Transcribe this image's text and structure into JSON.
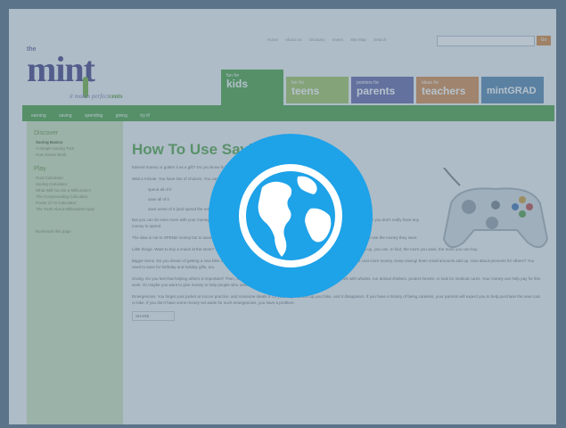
{
  "topbar": {
    "links": [
      "Home",
      "About Us",
      "Glossary",
      "Invest",
      "Site Map",
      "Search"
    ],
    "search_button": "Go"
  },
  "logo": {
    "the": "the",
    "mint": "mint",
    "tagline": "it makes perfect",
    "tagline_emphasis": "cents"
  },
  "tabs": [
    {
      "small": "fun for",
      "big": "kids"
    },
    {
      "small": "fun for",
      "big": "teens"
    },
    {
      "small": "pointers for",
      "big": "parents"
    },
    {
      "small": "ideas for",
      "big": "teachers"
    },
    {
      "small": "",
      "big": "mintGRAD"
    }
  ],
  "nav": [
    "earning",
    "saving",
    "spending",
    "giving",
    "try it!"
  ],
  "sidebar": {
    "discover_heading": "Discover",
    "discover_items": [
      "Saving Basics",
      "A Simple Saving Trick",
      "How Saves Work"
    ],
    "play_heading": "Play",
    "play_items": [
      "Goal Calculator",
      "Saving Calculator",
      "What Will You Be a Millionaire?",
      "The Compounding Calculator",
      "Power of 72 Calculator",
      "The Truth About Millionaires Quiz"
    ],
    "footer": "Bookmark this page"
  },
  "content": {
    "title": "How To Use Saving",
    "intro": "Earned money or gotten it as a gift? Do you know how to save it and spend it?",
    "wait": "Wait a minute. You have lots of choices. You can:",
    "choices": [
      "spend all of it",
      "save all of it",
      "save some of it (and spend the rest)"
    ],
    "p1": "But you can do even more with your money if you save it. You may think saving is boring and for grown-ups. But if you save money, then you don't really have any money to spend.",
    "p2": "The idea is not to SPEND money but to save some of it. That is a good idea, but really it is all about SAVING. Here's how smart people use the money they save:",
    "little": "Little things. Want to buy a snack at the store? Want to buy a new video game? Go to the movies? If you have enough money saved up, you can. In fact, the more you save, the more you can buy.",
    "bigger": "Bigger items. Do you dream of getting a new bike or a new game? Then you'll need even more time to save because these items cost more money. Keep saving! Even small amounts add up. How about presents for others? You need to save for birthday and holiday gifts, too.",
    "giving": "Giving. Do you feel that helping others is important? Then, save some money for giving, too. You can help those who work with whales, run animal shelters, protect forests, or look for medical cures. Your money can help pay for this work. Or maybe you want to give money to help people who need money.",
    "emergencies": "Emergencies. You forget your jacket at soccer practice, and someone steals it. Or you forget to lock up your bike, and it disappears. If you have a history of being careless, your parents will expect you to help purchase the new coat or bike. If you don't have some money set aside for such emergencies, you have a problem.",
    "share": "SHARE"
  },
  "overlay": {
    "icon": "globe-icon"
  }
}
